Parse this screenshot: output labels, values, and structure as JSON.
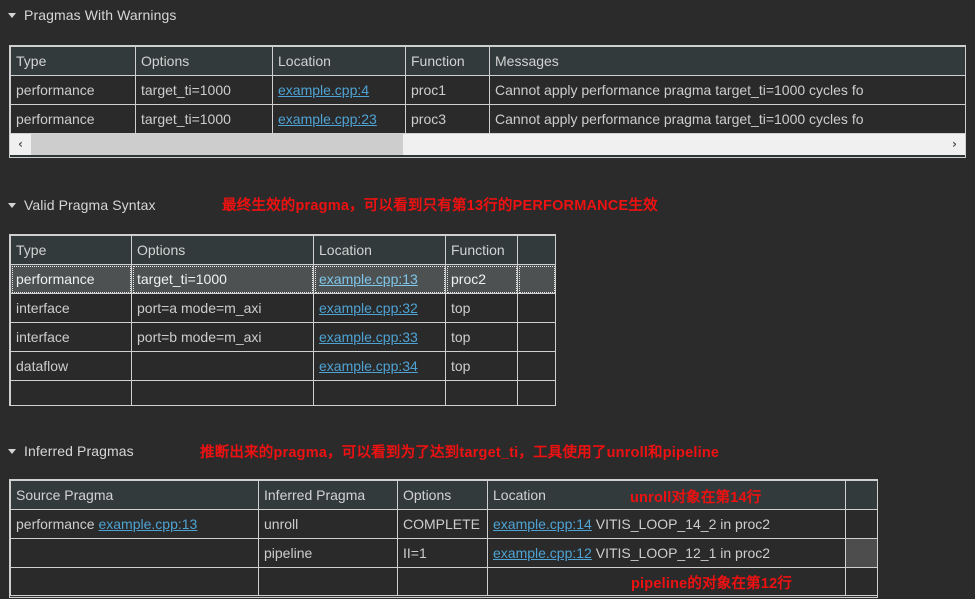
{
  "sections": [
    {
      "title": "Pragmas With Warnings",
      "columns": [
        "Type",
        "Options",
        "Location",
        "Function",
        "Messages"
      ],
      "rows": [
        {
          "type": "performance",
          "options": "target_ti=1000",
          "location": "example.cpp:4",
          "function": "proc1",
          "messages": "Cannot apply performance pragma target_ti=1000 cycles fo"
        },
        {
          "type": "performance",
          "options": "target_ti=1000",
          "location": "example.cpp:23",
          "function": "proc3",
          "messages": "Cannot apply performance pragma target_ti=1000 cycles fo"
        }
      ],
      "scrollbar": {
        "left_arrow": "‹",
        "right_arrow": "›"
      }
    },
    {
      "title": "Valid Pragma Syntax",
      "annotation": "最终生效的pragma，可以看到只有第13行的PERFORMANCE生效",
      "columns": [
        "Type",
        "Options",
        "Location",
        "Function",
        ""
      ],
      "rows": [
        {
          "type": "performance",
          "options": "target_ti=1000",
          "location": "example.cpp:13",
          "function": "proc2",
          "extra": "",
          "selected": true
        },
        {
          "type": "interface",
          "options": "port=a mode=m_axi",
          "location": "example.cpp:32",
          "function": "top",
          "extra": "",
          "selected": false
        },
        {
          "type": "interface",
          "options": "port=b mode=m_axi",
          "location": "example.cpp:33",
          "function": "top",
          "extra": "",
          "selected": false
        },
        {
          "type": "dataflow",
          "options": "",
          "location": "example.cpp:34",
          "function": "top",
          "extra": "",
          "selected": false
        },
        {
          "type": "",
          "options": "",
          "location": "",
          "function": "",
          "extra": "",
          "selected": false
        }
      ]
    },
    {
      "title": "Inferred Pragmas",
      "annotation": "推断出来的pragma，可以看到为了达到target_ti，工具使用了unroll和pipeline",
      "annotation_unroll": "unroll对象在第14行",
      "annotation_pipeline": "pipeline的对象在第12行",
      "columns": [
        "Source Pragma",
        "Inferred Pragma",
        "Options",
        "Location",
        ""
      ],
      "rows": [
        {
          "source_pragma_prefix": "performance ",
          "source_pragma_link": "example.cpp:13",
          "inferred_pragma": "unroll",
          "options": "COMPLETE",
          "location_link": "example.cpp:14",
          "location_rest": " VITIS_LOOP_14_2 in proc2",
          "extra": ""
        },
        {
          "source_pragma_prefix": "",
          "source_pragma_link": "",
          "inferred_pragma": "pipeline",
          "options": "II=1",
          "location_link": "example.cpp:12",
          "location_rest": " VITIS_LOOP_12_1 in proc2",
          "extra": ""
        },
        {
          "source_pragma_prefix": "",
          "source_pragma_link": "",
          "inferred_pragma": "",
          "options": "",
          "location_link": "",
          "location_rest": "",
          "extra": ""
        }
      ]
    }
  ],
  "colors": {
    "background": "#2b2b2b",
    "grid_background": "#2a2a2a",
    "header_background": "#333a3c",
    "border": "#d0d0d0",
    "link": "#4ea3d4",
    "annotation": "#ee1111",
    "selected_row": "#4d5152"
  }
}
